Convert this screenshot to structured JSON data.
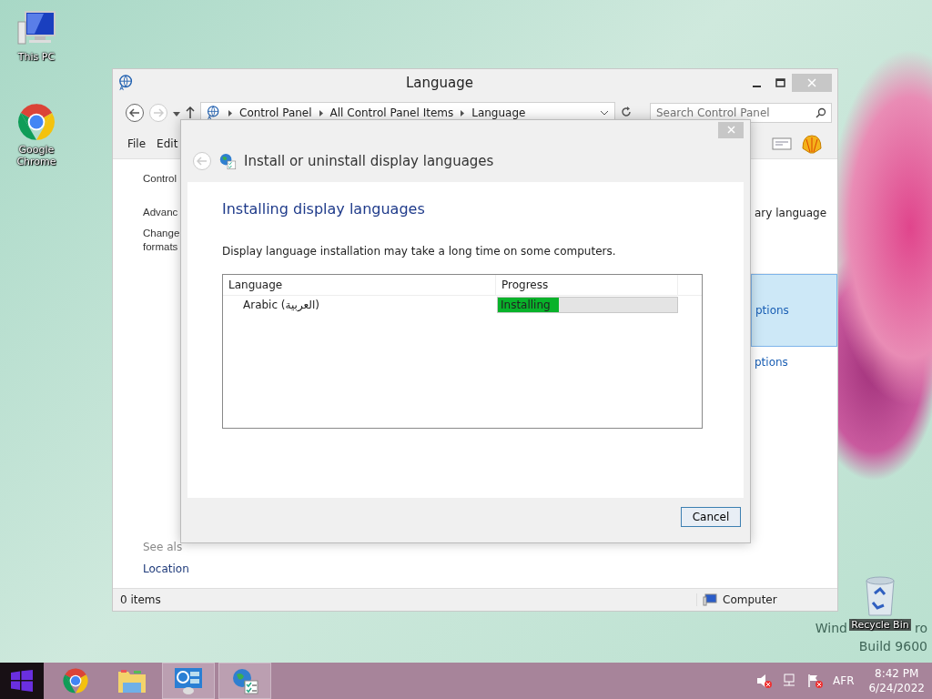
{
  "desktop_icons": [
    {
      "label": "This PC",
      "kind": "computer"
    },
    {
      "label": "Google Chrome",
      "kind": "chrome"
    },
    {
      "label": "Recycle Bin",
      "kind": "recycle"
    }
  ],
  "os_watermark": {
    "line_1_start": "Wind",
    "line_1_end": "ro",
    "line_2": "Build 9600"
  },
  "main_window": {
    "title": "Language",
    "breadcrumb": [
      "Control Panel",
      "All Control Panel Items",
      "Language"
    ],
    "search": {
      "placeholder": "Search Control Panel"
    },
    "menu": [
      "File",
      "Edit"
    ],
    "left_pane": [
      "Control",
      "Advanc",
      "Change",
      "formats"
    ],
    "right_pane": [
      {
        "text": "ary language",
        "selected": false
      },
      {
        "text": "ptions",
        "selected": true
      },
      {
        "text": "ptions",
        "selected": false
      }
    ],
    "see_also": {
      "heading": "See als",
      "links": [
        "Location"
      ]
    },
    "status_bar": {
      "items": "0 items",
      "location": "Computer"
    }
  },
  "dialog": {
    "title": "Install or uninstall display languages",
    "heading": "Installing display languages",
    "note": "Display language installation may take a long time on some computers.",
    "table": {
      "columns": [
        "Language",
        "Progress"
      ],
      "rows": [
        {
          "language": "Arabic (العربية)",
          "status": "Installing",
          "level": 0.34
        }
      ]
    },
    "buttons": [
      "Cancel"
    ]
  },
  "taskbar": {
    "apps": [
      {
        "kind": "chrome",
        "active": false
      },
      {
        "kind": "explorer",
        "active": false
      },
      {
        "kind": "control-panel",
        "active": true
      },
      {
        "kind": "language",
        "active": true
      }
    ],
    "tray": {
      "input_language": "AFR",
      "time": "8:42 PM",
      "date": "6/24/2022"
    }
  }
}
